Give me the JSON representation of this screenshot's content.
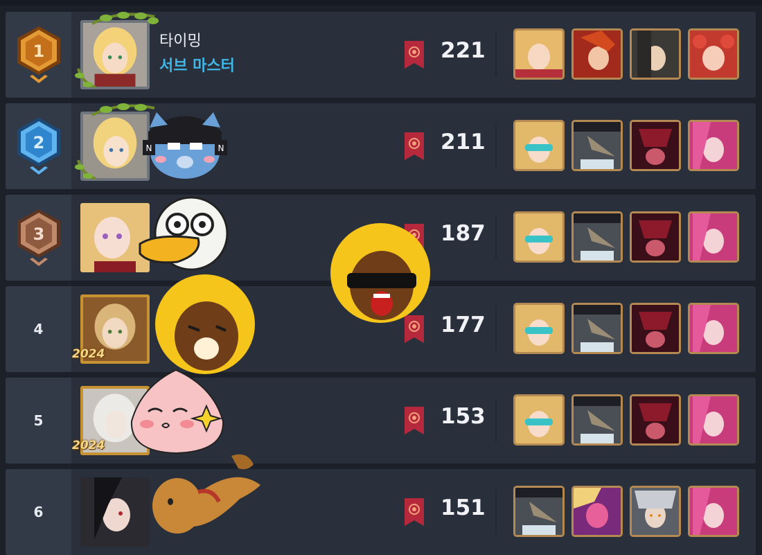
{
  "rows": [
    {
      "rank": "1",
      "name": "타이밍",
      "title": "서브 마스터",
      "score": "221",
      "frame": "silver",
      "year_badge": "",
      "team": [
        "hero-blonde-red",
        "hero-redhair-fierce",
        "hero-darkhair-glasses",
        "hero-redhair-smile"
      ]
    },
    {
      "rank": "2",
      "name": "",
      "title": "",
      "score": "211",
      "frame": "silver",
      "year_badge": "",
      "team": [
        "hero-blonde-visor",
        "hero-plague-doctor",
        "hero-crimson-helmet",
        "hero-pink-hair"
      ]
    },
    {
      "rank": "3",
      "name": "",
      "title": "",
      "score": "187",
      "frame": "none",
      "year_badge": "",
      "team": [
        "hero-blonde-visor",
        "hero-plague-doctor",
        "hero-crimson-helmet",
        "hero-pink-hair"
      ]
    },
    {
      "rank": "4",
      "name": "",
      "title": "",
      "score": "177",
      "frame": "gold",
      "year_badge": "2024",
      "team": [
        "hero-blonde-visor",
        "hero-plague-doctor",
        "hero-crimson-helmet",
        "hero-pink-hair"
      ]
    },
    {
      "rank": "5",
      "name": "",
      "title": "",
      "score": "153",
      "frame": "gold",
      "year_badge": "2024",
      "team": [
        "hero-blonde-visor",
        "hero-plague-doctor",
        "hero-crimson-helmet",
        "hero-pink-hair"
      ]
    },
    {
      "rank": "6",
      "name": "",
      "title": "",
      "score": "151",
      "frame": "none",
      "year_badge": "",
      "team": [
        "hero-plague-doctor",
        "hero-pink-demon",
        "hero-silver-hair",
        "hero-pink-hair"
      ]
    }
  ],
  "icons": {
    "score": "banner-sun-icon"
  },
  "emotes": [
    "ryan-emote",
    "tube-emote",
    "frodo-emote",
    "apeach-emote",
    "frodo-sunglasses-emote",
    "dog-emote"
  ],
  "colors": {
    "gold": "#d8902e",
    "silver": "#3c8fd0",
    "bronze": "#9a6648",
    "title": "#3fb7e8"
  }
}
